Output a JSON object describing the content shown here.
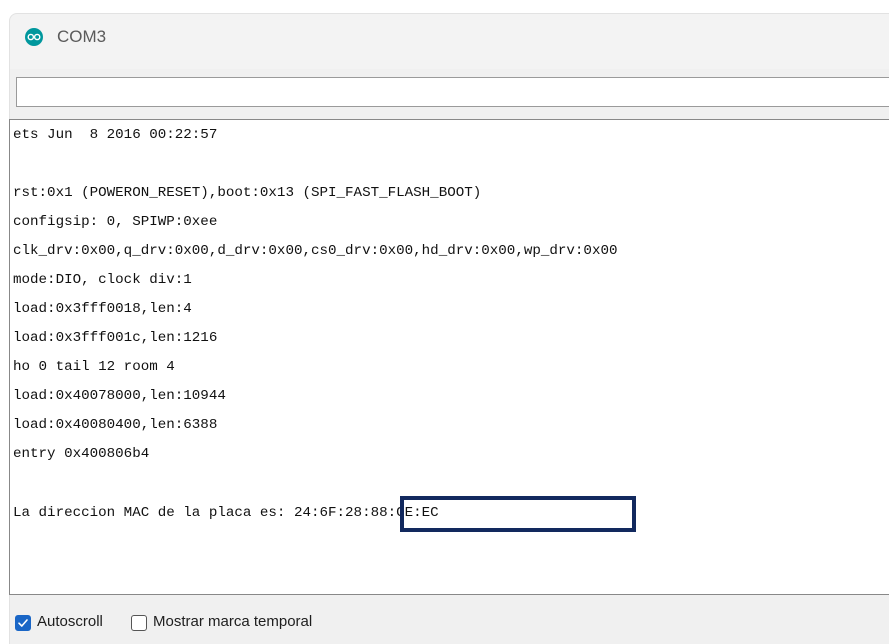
{
  "window": {
    "title": "COM3",
    "app_icon": "arduino-infinity-icon"
  },
  "send": {
    "value": ""
  },
  "console": {
    "lines": [
      "ets Jun  8 2016 00:22:57",
      "",
      "rst:0x1 (POWERON_RESET),boot:0x13 (SPI_FAST_FLASH_BOOT)",
      "configsip: 0, SPIWP:0xee",
      "clk_drv:0x00,q_drv:0x00,d_drv:0x00,cs0_drv:0x00,hd_drv:0x00,wp_drv:0x00",
      "mode:DIO, clock div:1",
      "load:0x3fff0018,len:4",
      "load:0x3fff001c,len:1216",
      "ho 0 tail 12 room 4",
      "load:0x40078000,len:10944",
      "load:0x40080400,len:6388",
      "entry 0x400806b4",
      "",
      "La direccion MAC de la placa es: 24:6F:28:88:CE:EC"
    ],
    "highlight_color": "#12295e"
  },
  "footer": {
    "autoscroll_label": "Autoscroll",
    "autoscroll_checked": true,
    "timestamp_label": "Mostrar marca temporal",
    "timestamp_checked": false,
    "accent_color": "#1a66c6"
  }
}
